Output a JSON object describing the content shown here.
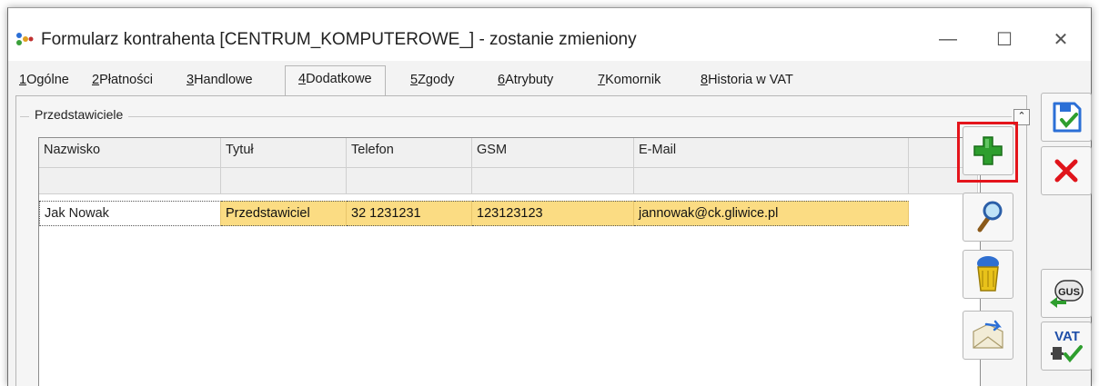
{
  "window": {
    "title": "Formularz kontrahenta [CENTRUM_KOMPUTEROWE_] - zostanie zmieniony",
    "minimize": "—",
    "maximize": "☐",
    "close": "✕"
  },
  "tabs": [
    {
      "key": "1",
      "label": "Ogólne"
    },
    {
      "key": "2",
      "label": "Płatności"
    },
    {
      "key": "3",
      "label": "Handlowe"
    },
    {
      "key": "4",
      "label": "Dodatkowe",
      "active": true
    },
    {
      "key": "5",
      "label": "Zgody"
    },
    {
      "key": "6",
      "label": "Atrybuty"
    },
    {
      "key": "7",
      "label": "Komornik"
    },
    {
      "key": "8",
      "label": "Historia w VAT"
    }
  ],
  "group": {
    "label": "Przedstawiciele",
    "collapse_glyph": "⌃"
  },
  "grid": {
    "columns": [
      "Nazwisko",
      "Tytuł",
      "Telefon",
      "GSM",
      "E-Mail"
    ],
    "rows": [
      {
        "nazwisko": "Jak Nowak",
        "tytul": "Przedstawiciel",
        "telefon": "32 1231231",
        "gsm": "123123123",
        "email": "jannowak@ck.gliwice.pl"
      }
    ]
  },
  "toolbar": {
    "add_icon": "plus-icon",
    "view_icon": "magnifier-icon",
    "delete_icon": "trash-icon",
    "send_icon": "envelope-icon",
    "save_icon": "save-icon",
    "cancel_icon": "cancel-icon",
    "gus_label": "GUS",
    "vat_label": "VAT"
  },
  "colors": {
    "selected_row": "#fbdc83",
    "highlight_border": "#e4141b",
    "add_green": "#2e9e2e",
    "cancel_red": "#e0141b"
  }
}
